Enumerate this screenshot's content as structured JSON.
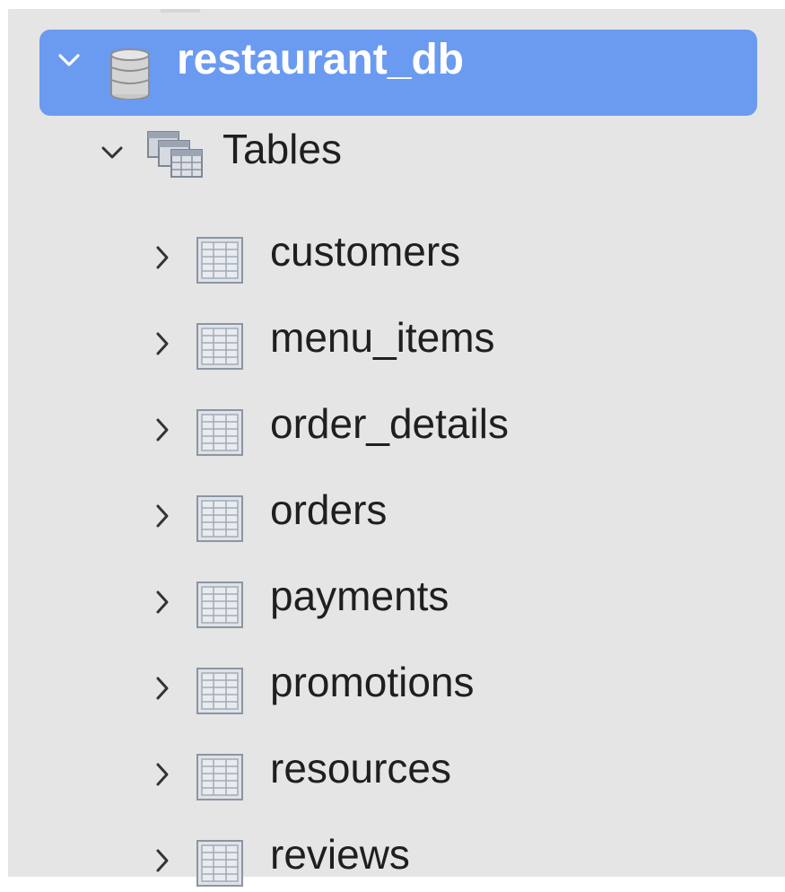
{
  "tree": {
    "database": {
      "name": "restaurant_db",
      "expanded": true,
      "icon": "database-icon",
      "highlight_color": "#6a9bf1"
    },
    "group": {
      "label": "Tables",
      "expanded": true,
      "icon": "tables-folder-icon"
    },
    "tables": [
      {
        "name": "customers"
      },
      {
        "name": "menu_items"
      },
      {
        "name": "order_details"
      },
      {
        "name": "orders"
      },
      {
        "name": "payments"
      },
      {
        "name": "promotions"
      },
      {
        "name": "resources"
      },
      {
        "name": "reviews"
      }
    ]
  }
}
